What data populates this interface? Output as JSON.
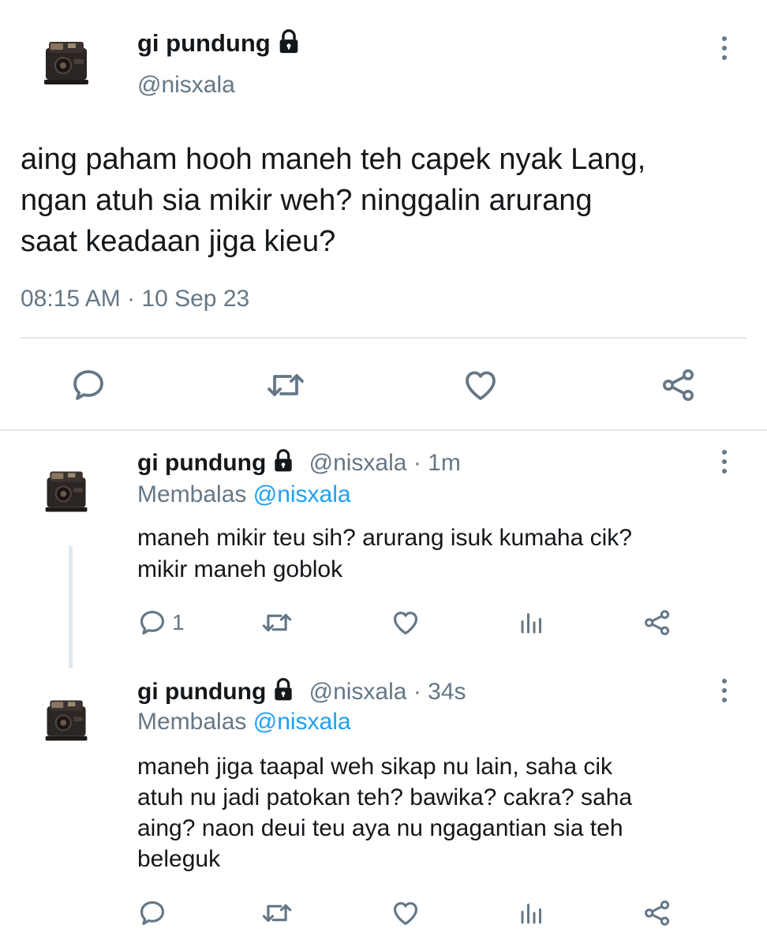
{
  "main_tweet": {
    "display_name": "gi pundung",
    "handle": "@nisxala",
    "text_lines": [
      "aing paham hooh maneh teh capek nyak Lang,",
      "ngan atuh sia mikir weh? ninggalin arurang",
      "saat keadaan jiga kieu?"
    ],
    "timestamp": "08:15 AM · 10 Sep 23",
    "actions": [
      "reply-icon",
      "retweet-icon",
      "like-icon",
      "share-icon"
    ]
  },
  "replies": [
    {
      "display_name": "gi pundung",
      "handle": "@nisxala",
      "time": "· 1m",
      "replying_label": "Membalas",
      "replying_to": "@nisxala",
      "text_lines": [
        "maneh mikir teu sih? arurang isuk kumaha cik?",
        "mikir maneh goblok"
      ],
      "reply_count": "1"
    },
    {
      "display_name": "gi pundung",
      "handle": "@nisxala",
      "time": "· 34s",
      "replying_label": "Membalas",
      "replying_to": "@nisxala",
      "text_lines": [
        "maneh jiga taapal weh sikap nu lain, saha cik",
        "atuh nu jadi patokan teh? bawika? cakra? saha",
        "aing? naon deui teu aya nu ngagantian sia teh",
        "beleguk"
      ]
    }
  ],
  "colors": {
    "text": "#14171a",
    "muted": "#657786",
    "link": "#1da1f2",
    "divider": "#e1e8ed"
  }
}
